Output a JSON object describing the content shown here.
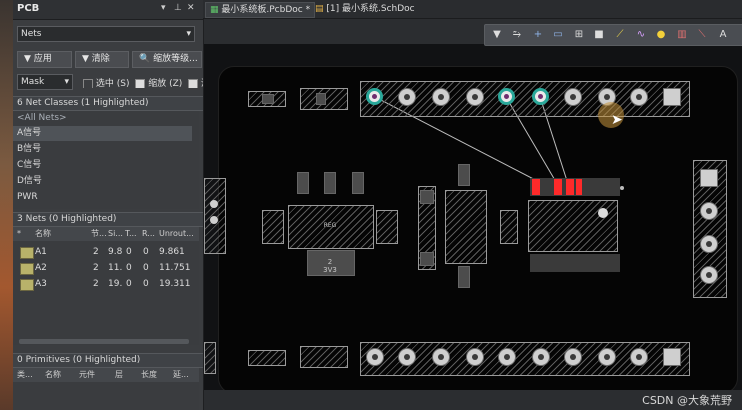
{
  "panel": {
    "title": "PCB",
    "header_icons": [
      "dropdown-icon",
      "pin-icon",
      "close-icon"
    ],
    "mode_select": "Nets",
    "buttons": {
      "apply": "应用",
      "clear": "清除",
      "zoom": "缩放等级..."
    },
    "mask_select": "Mask",
    "checkboxes": {
      "select": "选中 (S)",
      "zoom": "缩放 (Z)",
      "clear": "清"
    },
    "net_classes_header": "6 Net Classes (1 Highlighted)",
    "net_classes": [
      "<All Nets>",
      "A信号",
      "B信号",
      "C信号",
      "D信号",
      "PWR"
    ],
    "nets_header": "3 Nets (0 Highlighted)",
    "nets_columns": [
      "*",
      "名称",
      "节...",
      "Si...",
      "T...",
      "R...",
      "Unrout..."
    ],
    "nets": [
      {
        "name": "A1",
        "nodes": "2",
        "si": "9.8",
        "t": "0",
        "r": "0",
        "unrouted": "9.861"
      },
      {
        "name": "A2",
        "nodes": "2",
        "si": "11.",
        "t": "0",
        "r": "0",
        "unrouted": "11.751"
      },
      {
        "name": "A3",
        "nodes": "2",
        "si": "19.",
        "t": "0",
        "r": "0",
        "unrouted": "19.311"
      }
    ],
    "primitives_header": "0 Primitives (0 Highlighted)",
    "primitives_columns": [
      "类...",
      "名称",
      "元件",
      "层",
      "长度",
      "延..."
    ]
  },
  "tabs": [
    {
      "label": "最小系统板.PcbDoc *",
      "active": true
    },
    {
      "label": "[1] 最小系统.SchDoc",
      "active": false
    }
  ],
  "toolbar_icons": [
    "filter-icon",
    "route-icon",
    "plus-icon",
    "select-rect-icon",
    "align-icon",
    "component-icon",
    "measure-icon",
    "arc-icon",
    "highlight-icon",
    "keepout-icon",
    "line-icon",
    "text-icon"
  ],
  "board_labels": {
    "u1": "3V3",
    "u1b": "2"
  },
  "colors": {
    "net_highlight": "#2aa89a",
    "ratsnest_red": "#ff2a2a",
    "board_bg": "#050505"
  },
  "watermark": "CSDN @大象荒野"
}
